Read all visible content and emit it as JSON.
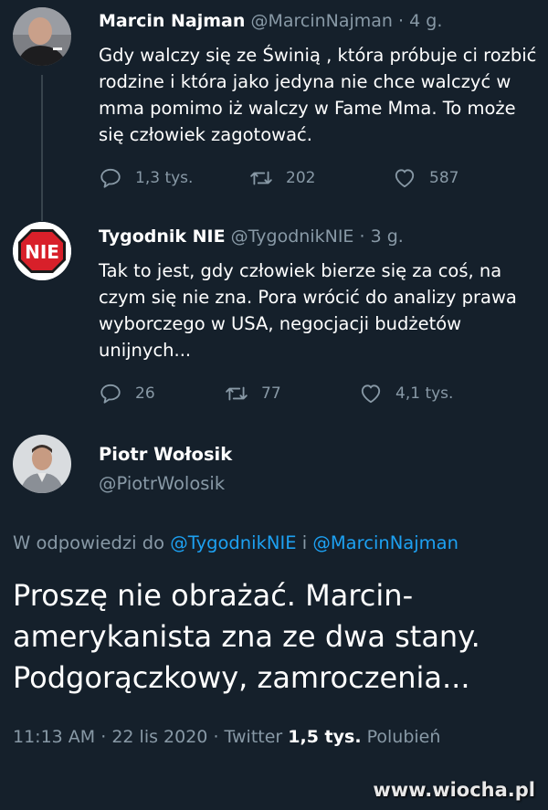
{
  "tweets": [
    {
      "name": "Marcin Najman",
      "handle": "@MarcinNajman",
      "time": "4 g.",
      "text": "Gdy walczy się ze Świnią , która próbuje ci rozbić rodzine i która jako jedyna nie chce walczyć w mma pomimo iż walczy w Fame Mma. To może się człowiek zagotować.",
      "replies": "1,3 tys.",
      "retweets": "202",
      "likes": "587"
    },
    {
      "name": "Tygodnik NIE",
      "handle": "@TygodnikNIE",
      "time": "3 g.",
      "text": "Tak to jest, gdy człowiek bierze się za coś, na czym się nie zna. Pora wrócić do analizy prawa wyborczego w USA, negocjacji budżetów unijnych...",
      "avatar_text": "NIE",
      "replies": "26",
      "retweets": "77",
      "likes": "4,1 tys."
    }
  ],
  "main": {
    "name": "Piotr Wołosik",
    "handle": "@PiotrWolosik",
    "reply_prefix": "W odpowiedzi do",
    "mention_1": "@TygodnikNIE",
    "reply_joiner": "i",
    "mention_2": "@MarcinNajman",
    "text": "Proszę nie obrażać. Marcin-amerykanista zna ze dwa stany. Podgorączkowy, zamroczenia...",
    "time": "11:13 AM",
    "date": "22 lis 2020",
    "source": "Twitter",
    "likes_count": "1,5 tys.",
    "likes_label": "Polubień"
  },
  "watermark": "www.wiocha.pl",
  "icons": [
    "reply-icon",
    "retweet-icon",
    "like-icon"
  ],
  "colors": {
    "background": "#15202b",
    "muted": "#8899a6",
    "link": "#1da1f2",
    "nie_red": "#d8202a"
  }
}
